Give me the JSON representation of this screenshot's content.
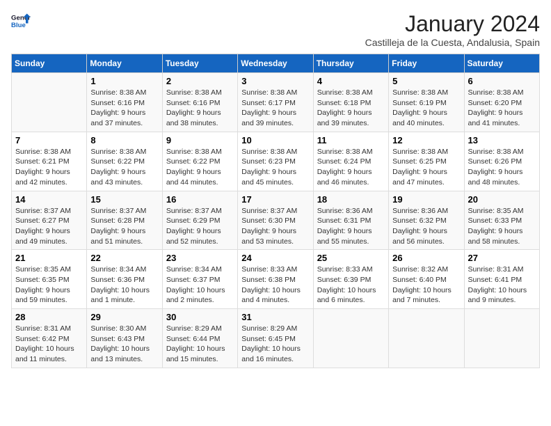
{
  "header": {
    "logo_general": "General",
    "logo_blue": "Blue",
    "month": "January 2024",
    "location": "Castilleja de la Cuesta, Andalusia, Spain"
  },
  "columns": [
    "Sunday",
    "Monday",
    "Tuesday",
    "Wednesday",
    "Thursday",
    "Friday",
    "Saturday"
  ],
  "weeks": [
    [
      {
        "day": "",
        "info": ""
      },
      {
        "day": "1",
        "info": "Sunrise: 8:38 AM\nSunset: 6:16 PM\nDaylight: 9 hours\nand 37 minutes."
      },
      {
        "day": "2",
        "info": "Sunrise: 8:38 AM\nSunset: 6:16 PM\nDaylight: 9 hours\nand 38 minutes."
      },
      {
        "day": "3",
        "info": "Sunrise: 8:38 AM\nSunset: 6:17 PM\nDaylight: 9 hours\nand 39 minutes."
      },
      {
        "day": "4",
        "info": "Sunrise: 8:38 AM\nSunset: 6:18 PM\nDaylight: 9 hours\nand 39 minutes."
      },
      {
        "day": "5",
        "info": "Sunrise: 8:38 AM\nSunset: 6:19 PM\nDaylight: 9 hours\nand 40 minutes."
      },
      {
        "day": "6",
        "info": "Sunrise: 8:38 AM\nSunset: 6:20 PM\nDaylight: 9 hours\nand 41 minutes."
      }
    ],
    [
      {
        "day": "7",
        "info": "Sunrise: 8:38 AM\nSunset: 6:21 PM\nDaylight: 9 hours\nand 42 minutes."
      },
      {
        "day": "8",
        "info": "Sunrise: 8:38 AM\nSunset: 6:22 PM\nDaylight: 9 hours\nand 43 minutes."
      },
      {
        "day": "9",
        "info": "Sunrise: 8:38 AM\nSunset: 6:22 PM\nDaylight: 9 hours\nand 44 minutes."
      },
      {
        "day": "10",
        "info": "Sunrise: 8:38 AM\nSunset: 6:23 PM\nDaylight: 9 hours\nand 45 minutes."
      },
      {
        "day": "11",
        "info": "Sunrise: 8:38 AM\nSunset: 6:24 PM\nDaylight: 9 hours\nand 46 minutes."
      },
      {
        "day": "12",
        "info": "Sunrise: 8:38 AM\nSunset: 6:25 PM\nDaylight: 9 hours\nand 47 minutes."
      },
      {
        "day": "13",
        "info": "Sunrise: 8:38 AM\nSunset: 6:26 PM\nDaylight: 9 hours\nand 48 minutes."
      }
    ],
    [
      {
        "day": "14",
        "info": "Sunrise: 8:37 AM\nSunset: 6:27 PM\nDaylight: 9 hours\nand 49 minutes."
      },
      {
        "day": "15",
        "info": "Sunrise: 8:37 AM\nSunset: 6:28 PM\nDaylight: 9 hours\nand 51 minutes."
      },
      {
        "day": "16",
        "info": "Sunrise: 8:37 AM\nSunset: 6:29 PM\nDaylight: 9 hours\nand 52 minutes."
      },
      {
        "day": "17",
        "info": "Sunrise: 8:37 AM\nSunset: 6:30 PM\nDaylight: 9 hours\nand 53 minutes."
      },
      {
        "day": "18",
        "info": "Sunrise: 8:36 AM\nSunset: 6:31 PM\nDaylight: 9 hours\nand 55 minutes."
      },
      {
        "day": "19",
        "info": "Sunrise: 8:36 AM\nSunset: 6:32 PM\nDaylight: 9 hours\nand 56 minutes."
      },
      {
        "day": "20",
        "info": "Sunrise: 8:35 AM\nSunset: 6:33 PM\nDaylight: 9 hours\nand 58 minutes."
      }
    ],
    [
      {
        "day": "21",
        "info": "Sunrise: 8:35 AM\nSunset: 6:35 PM\nDaylight: 9 hours\nand 59 minutes."
      },
      {
        "day": "22",
        "info": "Sunrise: 8:34 AM\nSunset: 6:36 PM\nDaylight: 10 hours\nand 1 minute."
      },
      {
        "day": "23",
        "info": "Sunrise: 8:34 AM\nSunset: 6:37 PM\nDaylight: 10 hours\nand 2 minutes."
      },
      {
        "day": "24",
        "info": "Sunrise: 8:33 AM\nSunset: 6:38 PM\nDaylight: 10 hours\nand 4 minutes."
      },
      {
        "day": "25",
        "info": "Sunrise: 8:33 AM\nSunset: 6:39 PM\nDaylight: 10 hours\nand 6 minutes."
      },
      {
        "day": "26",
        "info": "Sunrise: 8:32 AM\nSunset: 6:40 PM\nDaylight: 10 hours\nand 7 minutes."
      },
      {
        "day": "27",
        "info": "Sunrise: 8:31 AM\nSunset: 6:41 PM\nDaylight: 10 hours\nand 9 minutes."
      }
    ],
    [
      {
        "day": "28",
        "info": "Sunrise: 8:31 AM\nSunset: 6:42 PM\nDaylight: 10 hours\nand 11 minutes."
      },
      {
        "day": "29",
        "info": "Sunrise: 8:30 AM\nSunset: 6:43 PM\nDaylight: 10 hours\nand 13 minutes."
      },
      {
        "day": "30",
        "info": "Sunrise: 8:29 AM\nSunset: 6:44 PM\nDaylight: 10 hours\nand 15 minutes."
      },
      {
        "day": "31",
        "info": "Sunrise: 8:29 AM\nSunset: 6:45 PM\nDaylight: 10 hours\nand 16 minutes."
      },
      {
        "day": "",
        "info": ""
      },
      {
        "day": "",
        "info": ""
      },
      {
        "day": "",
        "info": ""
      }
    ]
  ]
}
